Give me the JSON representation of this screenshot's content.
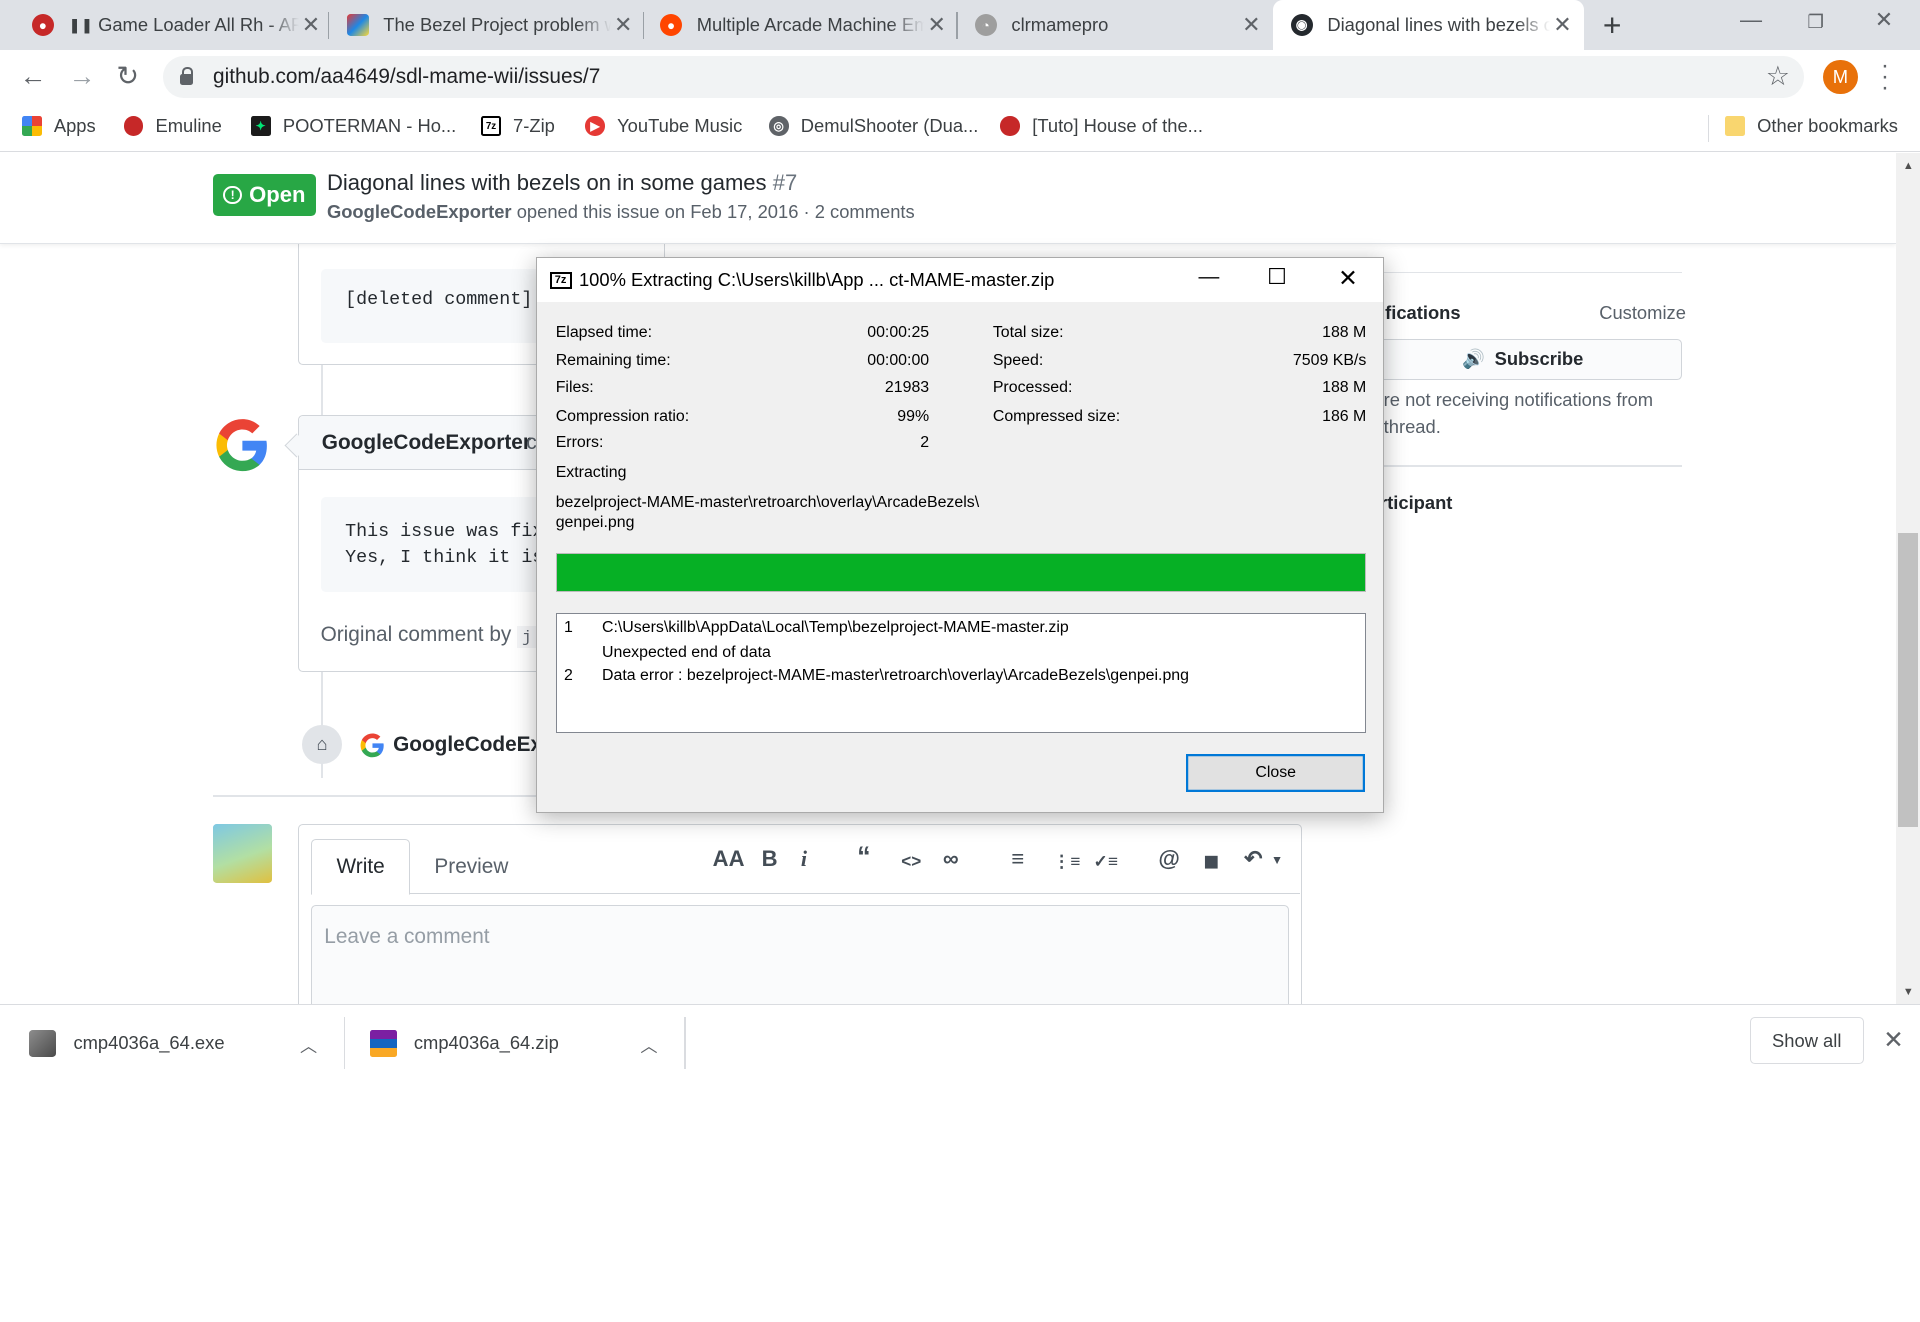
{
  "tabs": [
    {
      "title": "Game Loader All Rh - AR",
      "icon": "joystick-icon"
    },
    {
      "title": "The Bezel Project problem w",
      "icon": "cube-icon"
    },
    {
      "title": "Multiple Arcade Machine Em",
      "icon": "reddit-icon"
    },
    {
      "title": "clrmamepro",
      "icon": "magnifier-icon"
    },
    {
      "title": "Diagonal lines with bezels o",
      "icon": "github-icon",
      "active": true
    }
  ],
  "address": {
    "url": "github.com/aa4649/sdl-mame-wii/issues/7"
  },
  "profile_initial": "M",
  "bookmarks": [
    {
      "label": "Apps",
      "icon": "apps-grid-icon"
    },
    {
      "label": "Emuline",
      "icon": "joystick-icon"
    },
    {
      "label": "POOTERMAN - Ho...",
      "icon": "pooterman-icon"
    },
    {
      "label": "7-Zip",
      "icon": "7zip-icon"
    },
    {
      "label": "YouTube Music",
      "icon": "youtube-music-icon"
    },
    {
      "label": "DemulShooter (Dua...",
      "icon": "globe-icon"
    },
    {
      "label": "[Tuto] House of the...",
      "icon": "joystick-icon"
    }
  ],
  "other_bookmarks": "Other bookmarks",
  "issue": {
    "state": "Open",
    "title": "Diagonal lines with bezels on in some games",
    "number": "#7",
    "author": "GoogleCodeExporter",
    "opened_text": "opened this issue on Feb 17, 2016 · 2 comments"
  },
  "comments": {
    "deleted": "[deleted comment]",
    "author2": "GoogleCodeExporter",
    "author2_suffix": "c",
    "code_line1": "This issue was fixed",
    "code_line2": "Yes, I think it is t",
    "original_comment": "Original comment by",
    "original_comment_code": "j",
    "label_event_author": "GoogleCodeExp"
  },
  "sidebar": {
    "notifications": "ifications",
    "customize": "Customize",
    "subscribe": "Subscribe",
    "not_receiving_1": "re not receiving notifications from",
    "not_receiving_2": "thread.",
    "participant": "rticipant"
  },
  "editor": {
    "tab_write": "Write",
    "tab_preview": "Preview",
    "placeholder": "Leave a comment",
    "tools": [
      "AA",
      "B",
      "i",
      "“",
      "<>",
      "∞",
      "≡",
      "⋮≡",
      "✓≡",
      "@",
      "◼",
      "↶"
    ]
  },
  "dialog": {
    "title": "100% Extracting C:\\Users\\killb\\App ... ct-MAME-master.zip",
    "left_stats": [
      {
        "label": "Elapsed time:",
        "value": "00:00:25"
      },
      {
        "label": "Remaining time:",
        "value": "00:00:00"
      },
      {
        "label": "Files:",
        "value": "21983"
      },
      {
        "label": "Compression ratio:",
        "value": "99%"
      },
      {
        "label": "Errors:",
        "value": "2"
      }
    ],
    "right_stats": [
      {
        "label": "Total size:",
        "value": "188 M"
      },
      {
        "label": "Speed:",
        "value": "7509 KB/s"
      },
      {
        "label": "Processed:",
        "value": "188 M"
      },
      {
        "label": "Compressed size:",
        "value": "186 M"
      }
    ],
    "action": "Extracting",
    "current_path": "bezelproject-MAME-master\\retroarch\\overlay\\ArcadeBezels\\",
    "current_file": "genpei.png",
    "progress_fraction": 1.0,
    "progress_color": "#06b025",
    "errors": [
      {
        "num": "1",
        "text": "C:\\Users\\killb\\AppData\\Local\\Temp\\bezelproject-MAME-master.zip"
      },
      {
        "num": "",
        "text": "Unexpected end of data"
      },
      {
        "num": "2",
        "text": "Data error : bezelproject-MAME-master\\retroarch\\overlay\\ArcadeBezels\\genpei.png"
      }
    ],
    "close_label": "Close"
  },
  "downloads": [
    {
      "name": "cmp4036a_64.exe",
      "icon": "exe-file-icon"
    },
    {
      "name": "cmp4036a_64.zip",
      "icon": "zip-file-icon"
    }
  ],
  "show_all": "Show all",
  "colors": {
    "open_green": "#28a745",
    "chrome_tabstrip": "#dee1e6",
    "link": "#0366d6"
  }
}
